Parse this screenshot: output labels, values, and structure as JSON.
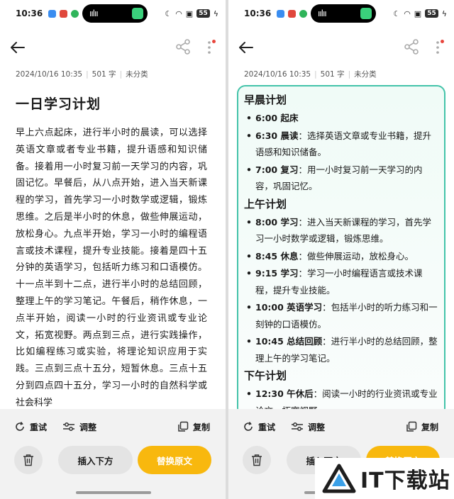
{
  "status_bar": {
    "time": "10:36",
    "battery": "55"
  },
  "meta": {
    "date": "2024/10/16 10:35",
    "word_count": "501 字",
    "category": "未分类"
  },
  "left": {
    "title": "一日学习计划",
    "body": "早上六点起床，进行半小时的晨读，可以选择英语文章或者专业书籍，提升语感和知识储备。接着用一小时复习前一天学习的内容，巩固记忆。早餐后，从八点开始，进入当天新课程的学习，首先学习一小时数学或逻辑，锻炼思维。之后是半小时的休息，做些伸展运动，放松身心。九点半开始，学习一小时的编程语言或技术课程，提升专业技能。接着是四十五分钟的英语学习，包括听力练习和口语模仿。十一点半到十二点，进行半小时的总结回顾，整理上午的学习笔记。午餐后，稍作休息，一点半开始，阅读一小时的行业资讯或专业论文，拓宽视野。两点到三点，进行实践操作，比如编程练习或实验，将理论知识应用于实践。三点到三点十五分，短暂休息。三点十五分到四点四十五分，学习一小时的自然科学或社会科学"
  },
  "right": {
    "sections": [
      {
        "title": "早晨计划",
        "items": [
          {
            "head": "6:00 起床",
            "text": ""
          },
          {
            "head": "6:30 晨读",
            "text": "：选择英语文章或专业书籍，提升语感和知识储备。"
          },
          {
            "head": "7:00 复习",
            "text": "：用一小时复习前一天学习的内容，巩固记忆。"
          }
        ]
      },
      {
        "title": "上午计划",
        "items": [
          {
            "head": "8:00 学习",
            "text": "：进入当天新课程的学习，首先学习一小时数学或逻辑，锻炼思维。"
          },
          {
            "head": "8:45 休息",
            "text": "：做些伸展运动，放松身心。"
          },
          {
            "head": "9:15 学习",
            "text": "：学习一小时编程语言或技术课程，提升专业技能。"
          },
          {
            "head": "10:00 英语学习",
            "text": "：包括半小时的听力练习和一刻钟的口语模仿。"
          },
          {
            "head": "10:45 总结回顾",
            "text": "：进行半小时的总结回顾，整理上午的学习笔记。"
          }
        ]
      },
      {
        "title": "下午计划",
        "items": [
          {
            "head": "12:30 午休后",
            "text": "：阅读一小时的行业资讯或专业论文，拓宽视野。"
          }
        ]
      }
    ]
  },
  "actions": {
    "retry": "重试",
    "adjust": "调整",
    "copy": "复制",
    "insert_below": "插入下方",
    "replace_original": "替换原文"
  },
  "watermark": {
    "text": "IT下载站"
  },
  "colors": {
    "accent_yellow": "#f8b80e",
    "card_border": "#43c3a9",
    "notification_dot": "#e8453c"
  }
}
